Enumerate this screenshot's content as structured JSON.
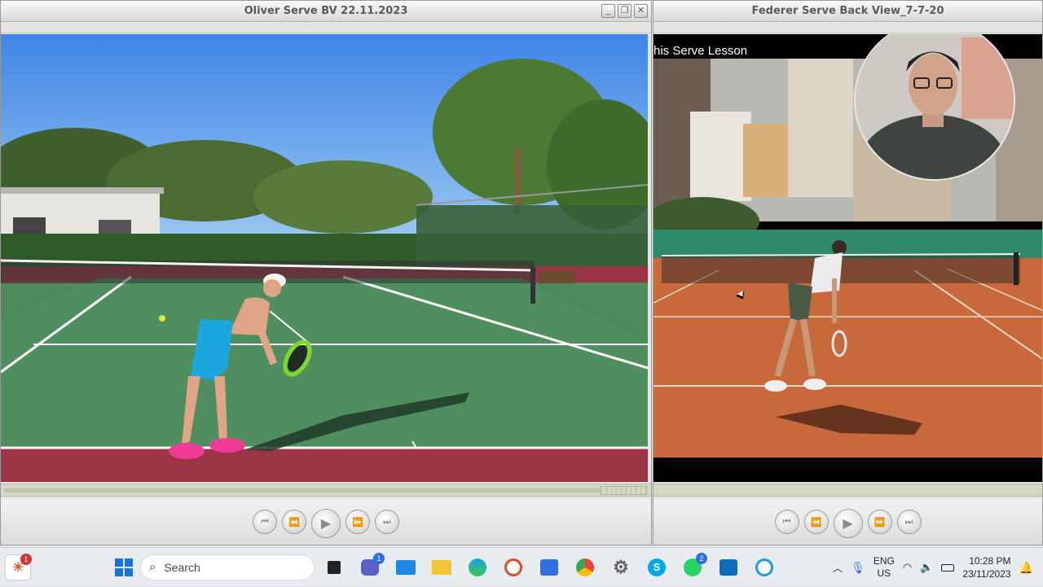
{
  "left_window": {
    "title": "Oliver Serve BV 22.11.2023",
    "controls": {
      "minimize": "minimize-icon",
      "restore": "restore-icon",
      "close": "close-icon"
    },
    "seek_progress": 0.93
  },
  "right_window": {
    "title": "Federer Serve Back View_7-7-20",
    "caption": "his Serve Lesson"
  },
  "player_controls": [
    "skip-back-icon",
    "rewind-icon",
    "play-icon",
    "fast-forward-icon",
    "skip-forward-icon"
  ],
  "taskbar": {
    "search_placeholder": "Search",
    "icons": [
      {
        "name": "start-icon"
      },
      {
        "name": "task-view-icon"
      },
      {
        "name": "teams-icon",
        "badge": "1"
      },
      {
        "name": "mail-icon"
      },
      {
        "name": "file-explorer-icon"
      },
      {
        "name": "edge-icon"
      },
      {
        "name": "recorder-app-icon"
      },
      {
        "name": "snipping-tool-icon"
      },
      {
        "name": "chrome-icon"
      },
      {
        "name": "settings-icon"
      },
      {
        "name": "skype-icon"
      },
      {
        "name": "whatsapp-icon",
        "badge": "2"
      },
      {
        "name": "outlook-icon"
      },
      {
        "name": "quicktime-icon"
      }
    ],
    "notification_badge": "1",
    "language": "ENG",
    "region": "US",
    "time": "10:28 PM",
    "date": "23/11/2023"
  },
  "colors": {
    "taskbar_bg": "#e8ecf0",
    "badge_red": "#d13438",
    "badge_blue": "#2f6fe0",
    "court_green": "#4e8a5c",
    "clay": "#c8693b"
  }
}
